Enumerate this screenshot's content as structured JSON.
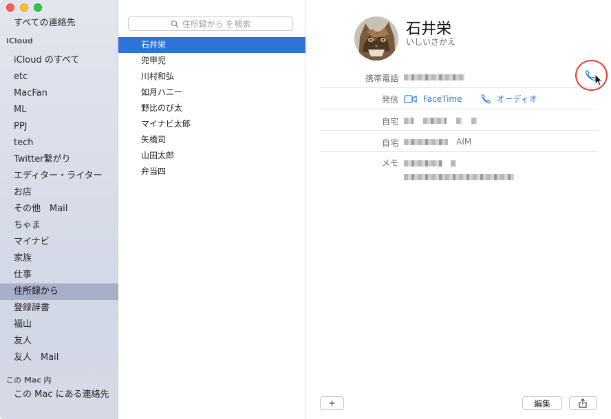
{
  "sidebar": {
    "all_contacts": "すべての連絡先",
    "section_icloud": "iCloud",
    "icloud_items": [
      "iCloud のすべて",
      "etc",
      "MacFan",
      "ML",
      "PPJ",
      "tech",
      "Twitter繋がり",
      "エディター・ライター",
      "お店",
      "その他　Mail",
      "ちゃま",
      "マイナビ",
      "家族",
      "仕事",
      "住所録から",
      "登録辞書",
      "福山",
      "友人",
      "友人　Mail"
    ],
    "selected_item": "住所録から",
    "section_mac": "この Mac 内",
    "mac_item": "この Mac にある連絡先"
  },
  "search": {
    "placeholder": "住所録から を検索"
  },
  "contacts": [
    "石井栄",
    "兜甲児",
    "川村和弘",
    "如月ハニー",
    "野比のび太",
    "マイナビ太郎",
    "矢橋司",
    "山田太郎",
    "弁当四"
  ],
  "selected_contact": "石井栄",
  "detail": {
    "name": "石井栄",
    "reading": "いしいさかえ",
    "mobile_label": "携帯電話",
    "facetime_label": "発信",
    "facetime_video": "FaceTime",
    "facetime_audio": "オーディオ",
    "home_label_1": "自宅",
    "home_label_2": "自宅",
    "aim_suffix": "AIM",
    "memo_label": "メモ"
  },
  "footer": {
    "add": "+",
    "edit": "編集"
  },
  "colors": {
    "selection_blue": "#2f72d8",
    "link_blue": "#2b7de1",
    "annotation_red": "#e8382a",
    "sidebar_selected": "#a6aec8"
  }
}
